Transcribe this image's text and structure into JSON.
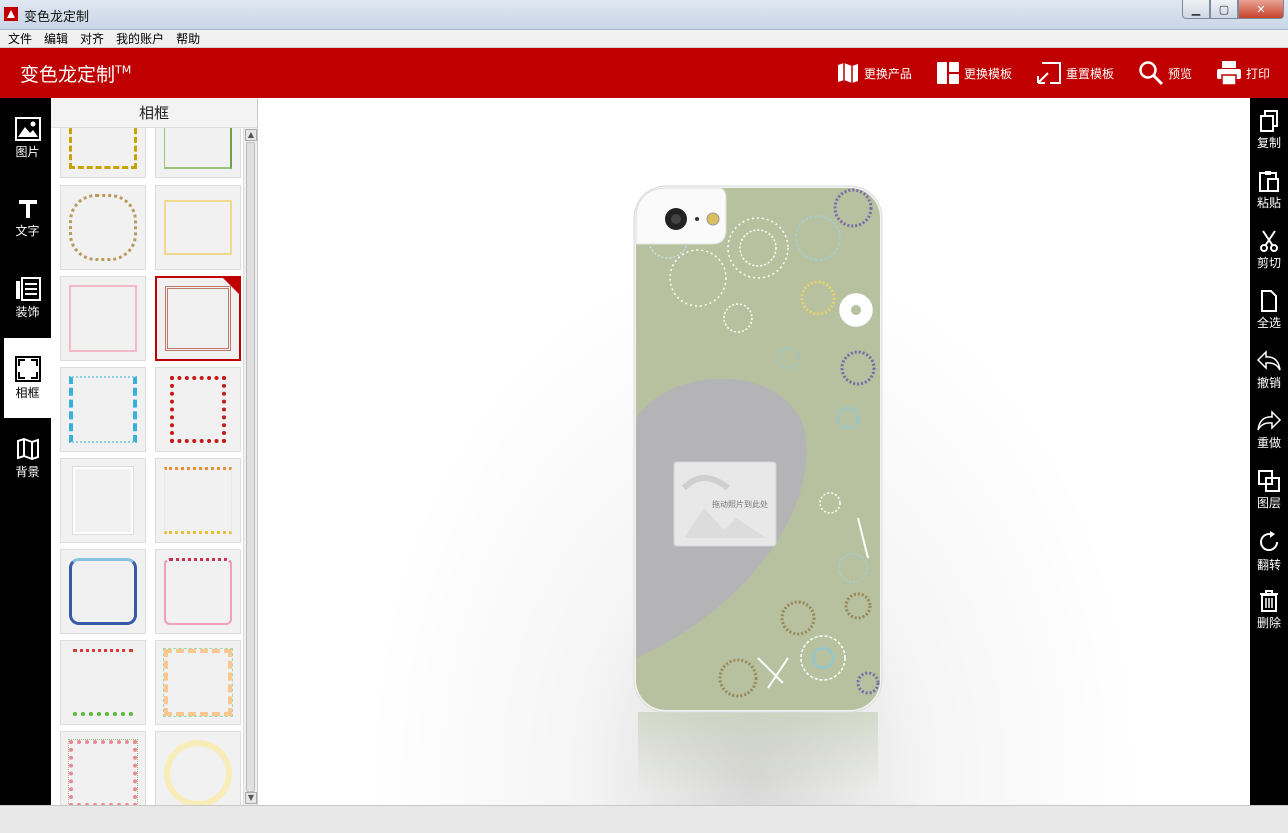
{
  "window": {
    "title": "变色龙定制"
  },
  "menu": [
    "文件",
    "编辑",
    "对齐",
    "我的账户",
    "帮助"
  ],
  "header": {
    "brand": "变色龙定制",
    "tm": "TM"
  },
  "toolbar": [
    {
      "label": "更换产品",
      "icon": "map-icon"
    },
    {
      "label": "更换模板",
      "icon": "template-icon"
    },
    {
      "label": "重置模板",
      "icon": "reset-icon"
    },
    {
      "label": "预览",
      "icon": "search-icon"
    },
    {
      "label": "打印",
      "icon": "printer-icon"
    }
  ],
  "leftnav": [
    {
      "label": "图片",
      "icon": "image-icon"
    },
    {
      "label": "文字",
      "icon": "text-icon"
    },
    {
      "label": "装饰",
      "icon": "decoration-icon"
    },
    {
      "label": "相框",
      "icon": "frame-icon",
      "active": true
    },
    {
      "label": "背景",
      "icon": "background-icon"
    }
  ],
  "panel": {
    "title": "相框",
    "selected_index": 5
  },
  "rightnav": [
    {
      "label": "复制",
      "icon": "copy-icon"
    },
    {
      "label": "粘贴",
      "icon": "paste-icon"
    },
    {
      "label": "剪切",
      "icon": "scissors-icon"
    },
    {
      "label": "全选",
      "icon": "select-all-icon"
    },
    {
      "label": "撤销",
      "icon": "undo-icon"
    },
    {
      "label": "重做",
      "icon": "redo-icon"
    },
    {
      "label": "图层",
      "icon": "layers-icon"
    },
    {
      "label": "翻转",
      "icon": "rotate-icon"
    },
    {
      "label": "删除",
      "icon": "trash-icon"
    }
  ],
  "canvas": {
    "drop_hint": "拖动照片到此处"
  },
  "colors": {
    "accent": "#c00000",
    "case_bg": "#b7c19f",
    "heart": "#b4b3b6"
  }
}
